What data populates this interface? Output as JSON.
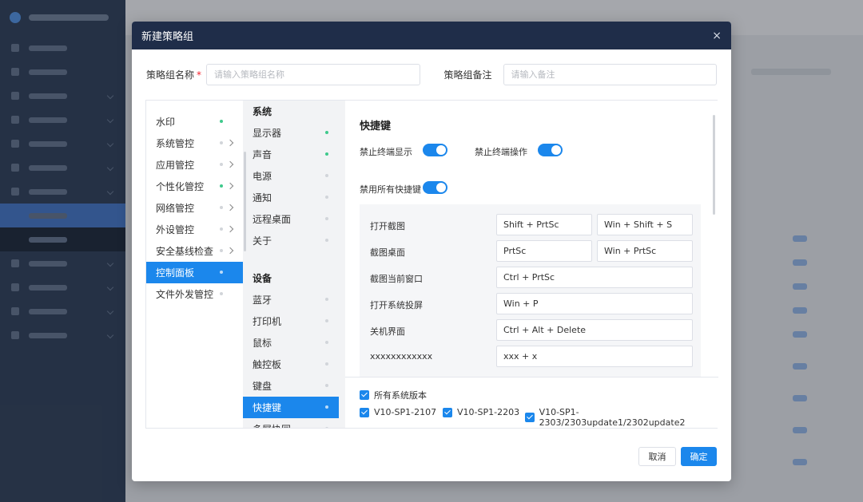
{
  "modal": {
    "title": "新建策略组",
    "close_glyph": "×",
    "name_label": "策略组名称",
    "required_mark": "*",
    "name_placeholder": "请输入策略组名称",
    "remark_label": "策略组备注",
    "remark_placeholder": "请输入备注",
    "cancel_label": "取消",
    "confirm_label": "确定"
  },
  "categories": [
    {
      "label": "水印",
      "status": "on",
      "arrow": false
    },
    {
      "label": "系统管控",
      "status": "off",
      "arrow": true
    },
    {
      "label": "应用管控",
      "status": "off",
      "arrow": true
    },
    {
      "label": "个性化管控",
      "status": "on",
      "arrow": true
    },
    {
      "label": "网络管控",
      "status": "off",
      "arrow": true
    },
    {
      "label": "外设管控",
      "status": "off",
      "arrow": true
    },
    {
      "label": "安全基线检查",
      "status": "off",
      "arrow": true
    },
    {
      "label": "控制面板",
      "status": "on",
      "arrow": false,
      "active": true
    },
    {
      "label": "文件外发管控",
      "status": "off",
      "arrow": false
    }
  ],
  "subgroups": [
    {
      "heading": "系统",
      "items": [
        {
          "label": "显示器",
          "status": "on"
        },
        {
          "label": "声音",
          "status": "on"
        },
        {
          "label": "电源",
          "status": "off"
        },
        {
          "label": "通知",
          "status": "off"
        },
        {
          "label": "远程桌面",
          "status": "off"
        },
        {
          "label": "关于",
          "status": "off"
        }
      ]
    },
    {
      "heading": "设备",
      "items": [
        {
          "label": "蓝牙",
          "status": "off"
        },
        {
          "label": "打印机",
          "status": "off"
        },
        {
          "label": "鼠标",
          "status": "off"
        },
        {
          "label": "触控板",
          "status": "off"
        },
        {
          "label": "键盘",
          "status": "off"
        },
        {
          "label": "快捷键",
          "status": "on",
          "active": true
        },
        {
          "label": "多屏协同",
          "status": "off"
        }
      ]
    }
  ],
  "detail": {
    "title": "快捷键",
    "toggles": [
      {
        "label": "禁止终端显示",
        "on": true
      },
      {
        "label": "禁止终端操作",
        "on": true
      },
      {
        "label": "禁用所有快捷键",
        "on": true
      }
    ],
    "shortcuts": [
      {
        "label": "打开截图",
        "keys": [
          "Shift + PrtSc",
          "Win + Shift + S"
        ]
      },
      {
        "label": "截图桌面",
        "keys": [
          "PrtSc",
          "Win +  PrtSc"
        ]
      },
      {
        "label": "截图当前窗口",
        "keys": [
          "Ctrl + PrtSc"
        ]
      },
      {
        "label": "打开系统投屏",
        "keys": [
          "Win + P"
        ]
      },
      {
        "label": "关机界面",
        "keys": [
          "Ctrl + Alt + Delete"
        ]
      },
      {
        "label": "xxxxxxxxxxxx",
        "keys": [
          "xxx + x"
        ]
      }
    ]
  },
  "versions": {
    "all_label": "所有系统版本",
    "items": [
      "V10-SP1-2107",
      "V10-SP1-2203",
      "V10-SP1-2303/2303update1/2302update2"
    ]
  },
  "colors": {
    "accent": "#1b87ec",
    "status_on": "#3fc98c",
    "header_bg": "#1f2d49"
  }
}
